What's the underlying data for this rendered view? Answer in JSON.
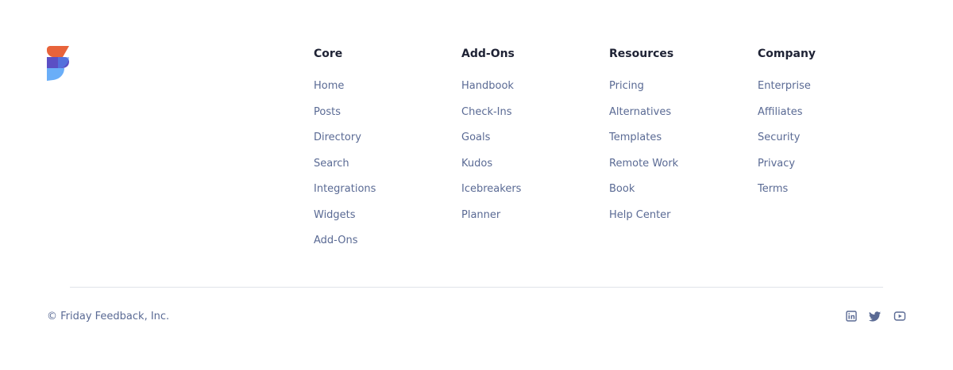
{
  "brand": {
    "logo_icon": "friday-logo-icon",
    "colors": {
      "orange": "#e8633a",
      "purple": "#5b4fc4",
      "light_blue": "#6aaef8",
      "heading": "#1f2335",
      "link": "#5a6a94",
      "divider": "#e0e3ea"
    }
  },
  "columns": [
    {
      "title": "Core",
      "links": [
        "Home",
        "Posts",
        "Directory",
        "Search",
        "Integrations",
        "Widgets",
        "Add-Ons"
      ]
    },
    {
      "title": "Add-Ons",
      "links": [
        "Handbook",
        "Check-Ins",
        "Goals",
        "Kudos",
        "Icebreakers",
        "Planner"
      ]
    },
    {
      "title": "Resources",
      "links": [
        "Pricing",
        "Alternatives",
        "Templates",
        "Remote Work",
        "Book",
        "Help Center"
      ]
    },
    {
      "title": "Company",
      "links": [
        "Enterprise",
        "Affiliates",
        "Security",
        "Privacy",
        "Terms"
      ]
    }
  ],
  "bottom": {
    "copyright": "© Friday Feedback, Inc.",
    "social": [
      "linkedin-icon",
      "twitter-icon",
      "youtube-icon"
    ]
  }
}
